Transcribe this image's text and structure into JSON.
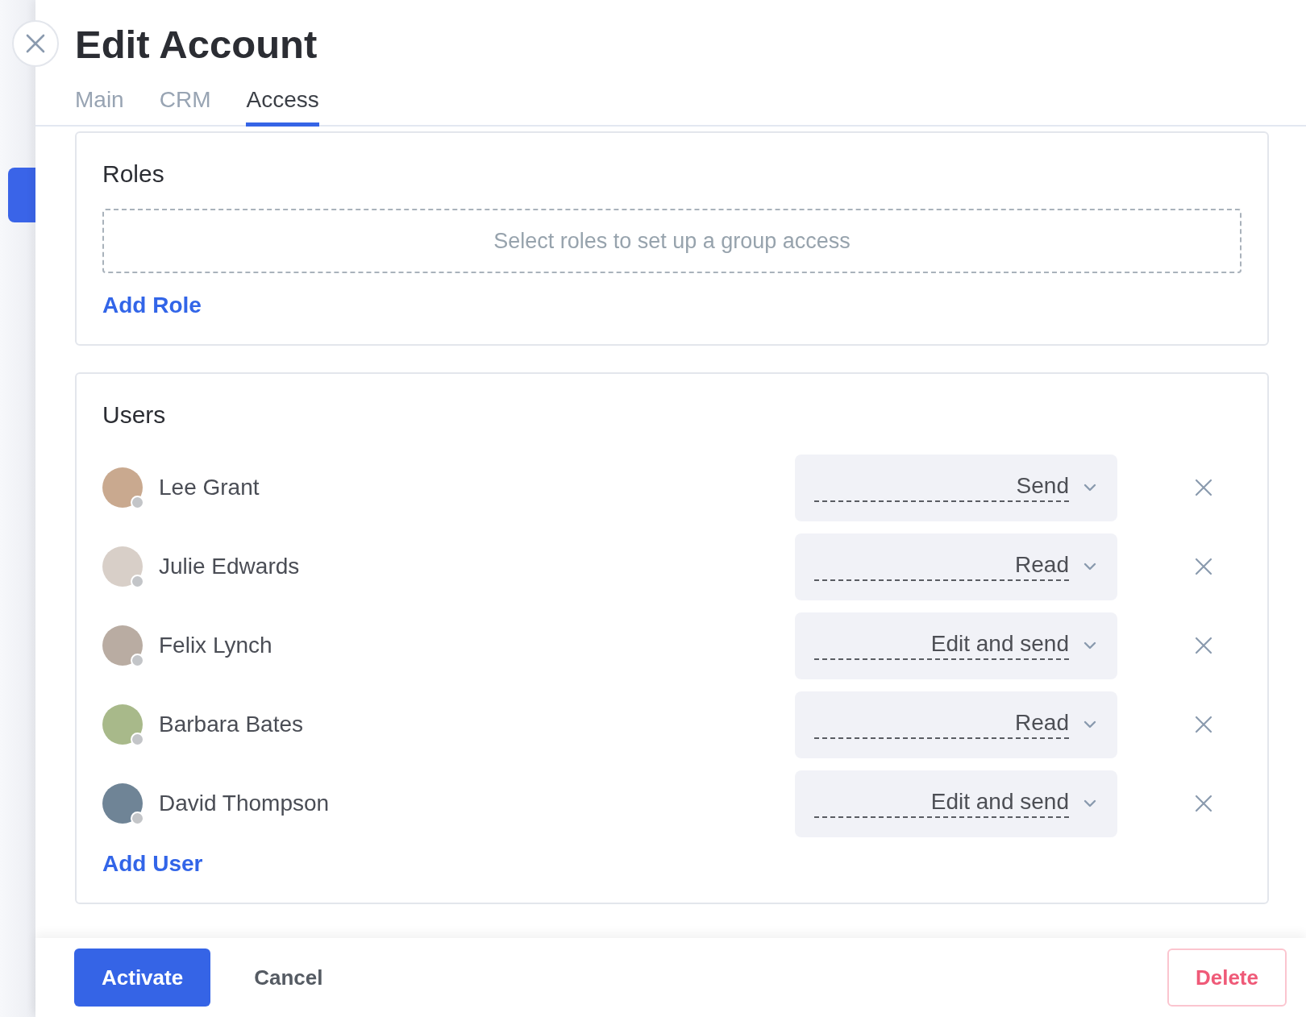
{
  "title": "Edit Account",
  "tabs": [
    {
      "label": "Main",
      "selected": false
    },
    {
      "label": "CRM",
      "selected": false
    },
    {
      "label": "Access",
      "selected": true
    }
  ],
  "roles": {
    "heading": "Roles",
    "placeholder": "Select roles to set up a group access",
    "add_link": "Add Role"
  },
  "users": {
    "heading": "Users",
    "add_link": "Add User",
    "items": [
      {
        "name": "Lee Grant",
        "online": false,
        "access": "Send"
      },
      {
        "name": "Julie Edwards",
        "online": false,
        "access": "Read"
      },
      {
        "name": "Felix Lynch",
        "online": false,
        "access": "Edit and send"
      },
      {
        "name": "Barbara Bates",
        "online": false,
        "access": "Read"
      },
      {
        "name": "David Thompson",
        "online": false,
        "access": "Edit and send"
      }
    ]
  },
  "footer": {
    "primary": "Activate",
    "secondary": "Cancel",
    "danger": "Delete"
  }
}
